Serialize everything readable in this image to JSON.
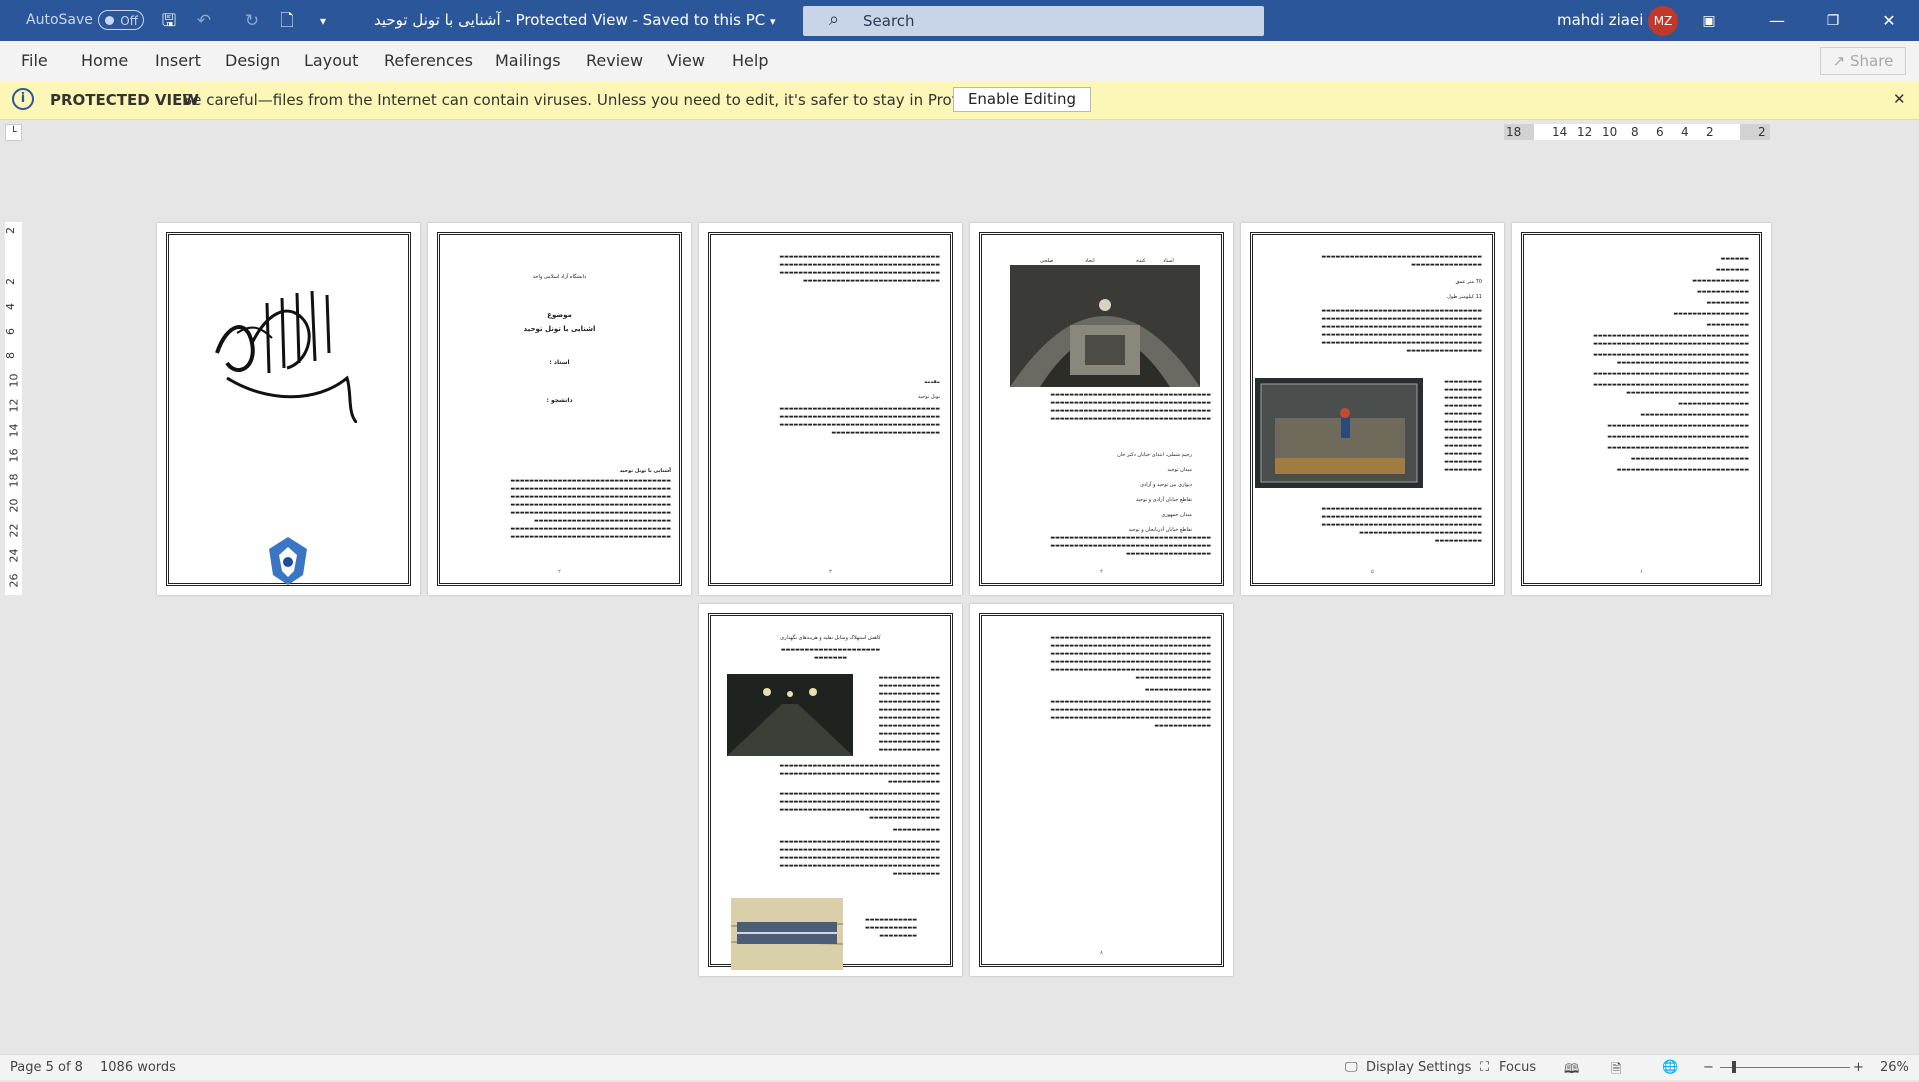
{
  "titlebar": {
    "autosave_label": "AutoSave",
    "autosave_state": "Off",
    "doc_title": "آشنایی با تونل توحید  -  Protected View  -  Saved to this PC",
    "search_placeholder": "Search",
    "user_name": "mahdi ziaei",
    "user_initials": "MZ"
  },
  "ribbon": {
    "tabs": [
      "File",
      "Home",
      "Insert",
      "Design",
      "Layout",
      "References",
      "Mailings",
      "Review",
      "View",
      "Help"
    ],
    "share_label": "Share"
  },
  "protected_view": {
    "title": "PROTECTED VIEW",
    "message": "Be careful—files from the Internet can contain viruses. Unless you need to edit, it's safer to stay in Protected View.",
    "button": "Enable Editing"
  },
  "ruler": {
    "horizontal_ticks": [
      "18",
      "14",
      "12",
      "10",
      "8",
      "6",
      "4",
      "2",
      "2"
    ],
    "vertical_ticks": [
      "2",
      "2",
      "4",
      "6",
      "8",
      "10",
      "12",
      "14",
      "16",
      "18",
      "20",
      "22",
      "24",
      "26"
    ]
  },
  "pages": {
    "p2": {
      "university": "دانشگاه آزاد اسلامی واحد",
      "subject_label": "موضوع",
      "subject": "آشنایی با تونل توحید",
      "professor": "استاد :",
      "student": "دانشجو :",
      "heading": "آشنایی با تونل توحید"
    },
    "p3": {
      "heading": "مقدمه",
      "sub": "تونل توحید"
    },
    "p4": {
      "caption_cols": [
        "صلحی",
        "انحاد",
        "کنده",
        "استاد"
      ],
      "list": [
        "رحیم شملی، ابتدای خیابان دکتر خان",
        "میدان توحید",
        "دیواری بین توحید و آزادی",
        "تقاطع خیابان آزادی و توحید",
        "میدان جمهوری",
        "تقاطع خیابان آذربایجان و توحید"
      ]
    },
    "p5": {
      "line1": "70 متر عمق",
      "line2": "11 کیلومتر طول"
    },
    "p7": {
      "heading": "کاهش استهلاک وسایل نقلیه و هزینه‌های نگهداری"
    },
    "page_numbers": [
      "۱",
      "۲",
      "۳",
      "۴",
      "۵",
      "۶",
      "۷",
      "۸"
    ]
  },
  "status": {
    "page": "Page 5 of 8",
    "words": "1086 words",
    "display_settings": "Display Settings",
    "focus": "Focus",
    "zoom": "26%"
  },
  "colors": {
    "titlebar": "#2b579a",
    "protected_bar": "#fcf7b6",
    "avatar": "#c0392b"
  }
}
